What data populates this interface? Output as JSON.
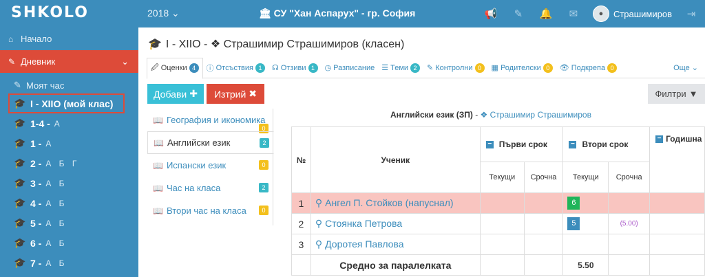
{
  "header": {
    "logo": "SHKOLO",
    "year": "2018 ⌄",
    "school": "СУ \"Хан Аспарух\" - гр. София",
    "user": "Страшимиров"
  },
  "sidebar": {
    "home": "Начало",
    "journal": "Дневник",
    "my_hour": "Моят час",
    "classes": [
      {
        "label": "I - XIIO (мой клас)",
        "sec": "",
        "selected": true
      },
      {
        "label": "1-4 -",
        "sec": "А"
      },
      {
        "label": "1 -",
        "sec": "А"
      },
      {
        "label": "2 -",
        "sec": "А Б Г"
      },
      {
        "label": "3 -",
        "sec": "А Б"
      },
      {
        "label": "4 -",
        "sec": "А Б"
      },
      {
        "label": "5 -",
        "sec": "А Б"
      },
      {
        "label": "6 -",
        "sec": "А Б"
      },
      {
        "label": "7 -",
        "sec": "А Б"
      }
    ]
  },
  "page": {
    "title": "I - XIIO - ❖ Страшимир Страшимиров (класен)"
  },
  "tabs": [
    {
      "label": "Оценки",
      "badge": "4",
      "color": "blue",
      "active": true,
      "icon": "🖉"
    },
    {
      "label": "Отсъствия",
      "badge": "1",
      "color": "teal",
      "icon": "ⓘ"
    },
    {
      "label": "Отзиви",
      "badge": "1",
      "color": "teal",
      "icon": "☊"
    },
    {
      "label": "Разписание",
      "badge": "",
      "color": "",
      "icon": "◷"
    },
    {
      "label": "Теми",
      "badge": "2",
      "color": "teal",
      "icon": "☰"
    },
    {
      "label": "Контролни",
      "badge": "0",
      "color": "yellow",
      "icon": "✎"
    },
    {
      "label": "Родителски",
      "badge": "0",
      "color": "yellow",
      "icon": "▦"
    },
    {
      "label": "Подкрепа",
      "badge": "0",
      "color": "yellow",
      "icon": "👁"
    }
  ],
  "tabs_more": "Още ⌄",
  "buttons": {
    "add": "Добави",
    "del": "Изтрий",
    "filter": "Филтри"
  },
  "subjects": [
    {
      "label": "География и икономика",
      "badge": "0",
      "color": "yellow",
      "low": true
    },
    {
      "label": "Английски език",
      "badge": "2",
      "color": "teal",
      "active": true
    },
    {
      "label": "Испански език",
      "badge": "0",
      "color": "yellow"
    },
    {
      "label": "Час на класа",
      "badge": "2",
      "color": "teal"
    },
    {
      "label": "Втори час на класа",
      "badge": "0",
      "color": "yellow"
    }
  ],
  "course": {
    "name": "Английски език (ЗП)",
    "sep": " - ",
    "teacher": "❖ Страшимир Страшимиров"
  },
  "table": {
    "col_no": "№",
    "col_student": "Ученик",
    "term1": "Първи срок",
    "term2": "Втори срок",
    "annual": "Годишна",
    "current": "Текущи",
    "final": "Срочна",
    "rows": [
      {
        "n": "1",
        "name": "Ангел П. Стойков (напуснал)",
        "t2cur": "6",
        "t2cls": "g6",
        "t2fin": "",
        "warn": true
      },
      {
        "n": "2",
        "name": "Стоянка Петрова",
        "t2cur": "5",
        "t2cls": "g5",
        "t2fin": "(5.00)"
      },
      {
        "n": "3",
        "name": "Доротея Павлова",
        "t2cur": "",
        "t2fin": ""
      }
    ],
    "avg_label": "Средно за паралелката",
    "avg_value": "5.50"
  }
}
